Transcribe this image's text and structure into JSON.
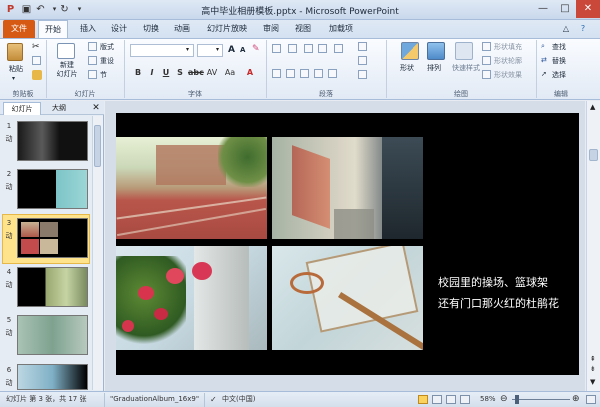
{
  "window": {
    "title": "高中毕业相册模板.pptx - Microsoft PowerPoint"
  },
  "tabs": [
    "文件",
    "开始",
    "插入",
    "设计",
    "切换",
    "动画",
    "幻灯片放映",
    "审阅",
    "视图",
    "加载项"
  ],
  "ribbon": {
    "clipboard": {
      "label": "剪贴板",
      "paste": "粘贴"
    },
    "slides": {
      "label": "幻灯片",
      "new_slide": "新建\n幻灯片",
      "layout": "版式",
      "reset": "重设",
      "section": "节"
    },
    "font": {
      "label": "字体"
    },
    "paragraph": {
      "label": "段落"
    },
    "drawing": {
      "label": "绘图",
      "shapes": "形状",
      "arrange": "排列",
      "quick_styles": "快速样式",
      "fill": "形状填充",
      "outline": "形状轮廓",
      "effects": "形状效果"
    },
    "editing": {
      "label": "编辑",
      "find": "查找",
      "replace": "替换",
      "select": "选择"
    }
  },
  "pane": {
    "tab_slides": "幻灯片",
    "tab_outline": "大纲"
  },
  "thumbnails": [
    {
      "num": "1",
      "mark": "动"
    },
    {
      "num": "2",
      "mark": "动"
    },
    {
      "num": "3",
      "mark": "动"
    },
    {
      "num": "4",
      "mark": "动"
    },
    {
      "num": "5",
      "mark": "动"
    },
    {
      "num": "6",
      "mark": "动"
    }
  ],
  "slide": {
    "caption_line1": "校园里的操场、篮球架",
    "caption_line2": "还有门口那火红的杜鹃花"
  },
  "status": {
    "slide_info": "幻灯片 第 3 张，共 17 张",
    "theme": "\"GraduationAlbum_16x9\"",
    "language": "中文(中国)",
    "zoom": "58%"
  },
  "colors": {
    "file_tab": "#d65a14",
    "accent": "#2b579a",
    "slide_bg": "#000000"
  }
}
